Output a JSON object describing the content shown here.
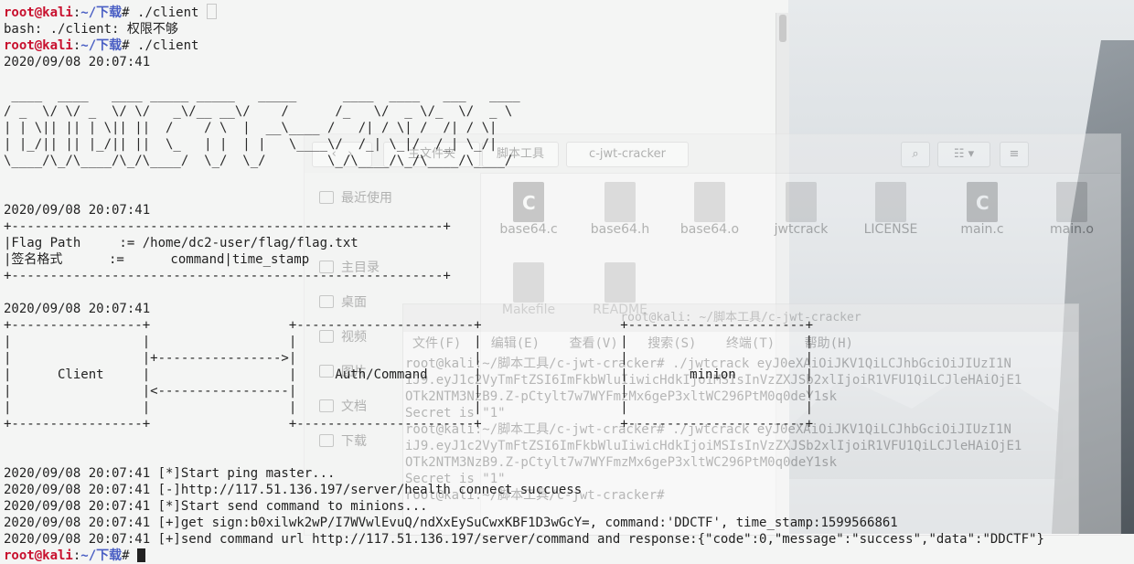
{
  "terminal": {
    "prompt_user": "root@kali",
    "prompt_sep": ":",
    "prompt_path": "~/下载",
    "prompt_hash": "# ",
    "cmd1": "./client",
    "error_line": "bash: ./client: 权限不够",
    "cmd2": "./client",
    "ts1": "2020/09/08 20:07:41",
    "banner": [
      " ____  ____   ____ _____ _____   _____      ____  ____   ___   ____ ",
      "/ _  \\/ \\/ _  \\/ \\/   _\\/__ __\\/    /      /_   \\/  _ \\/_  \\/  _ \\",
      "| | \\|| || | \\|| ||  /    / \\  |  __\\____ /   /| / \\| /  /| / \\|",
      "| |_/|| || |_/|| ||  \\_   | |  | |   \\____\\/  /_| \\_|/  /_| \\_/|",
      "\\____/\\_/\\____/\\_/\\____/  \\_/  \\_/        \\_/\\____/\\_/\\____/\\____/"
    ],
    "ts2": "2020/09/08 20:07:41",
    "table_border": "+--------------------------------------------------------+",
    "flag_row": "|Flag Path     := /home/dc2-user/flag/flag.txt",
    "sign_row": "|签名格式      :=      command|time_stamp",
    "ts3": "2020/09/08 20:07:41",
    "diagram": [
      "+-----------------+                  +-----------------------+                  +-----------------------+",
      "|                 |                  |                       |                  |                       |",
      "|                 |+---------------->|                       |                  |                       |",
      "|      Client     |                  |     Auth/Command      |                  |        minion         |",
      "|                 |<-----------------|                       |                  |                       |",
      "|                 |                  |                       |                  |                       |",
      "+-----------------+                  +-----------------------+                  +-----------------------+"
    ],
    "log": [
      "2020/09/08 20:07:41 [*]Start ping master...",
      "2020/09/08 20:07:41 [-]http://117.51.136.197/server/health connect succuess",
      "2020/09/08 20:07:41 [*]Start send command to minions...",
      "2020/09/08 20:07:41 [+]get sign:b0xilwk2wP/I7WVwlEvuQ/ndXxEySuCwxKBF1D3wGcY=, command:'DDCTF', time_stamp:1599566861",
      "2020/09/08 20:07:41 [+]send command url http://117.51.136.197/server/command and response:{\"code\":0,\"message\":\"success\",\"data\":\"DDCTF\"}"
    ]
  },
  "file_manager": {
    "breadcrumb": [
      "主文件夹",
      "脚本工具",
      "c-jwt-cracker"
    ],
    "sidebar": [
      "最近使用",
      "主目录",
      "桌面",
      "视频",
      "图片",
      "文档",
      "下载"
    ],
    "files": [
      "base64.c",
      "base64.h",
      "base64.o",
      "jwtcrack",
      "LICENSE",
      "main.c",
      "main.o",
      "Makefile",
      "README"
    ]
  },
  "terminal2": {
    "title": "root@kali: ~/脚本工具/c-jwt-cracker",
    "menu": [
      "文件(F)",
      "编辑(E)",
      "查看(V)",
      "搜索(S)",
      "终端(T)",
      "帮助(H)"
    ],
    "lines": [
      "root@kali:~/脚本工具/c-jwt-cracker# ./jwtcrack eyJ0eXAiOiJKV1QiLCJhbGciOiJIUzI1N",
      "iJ9.eyJ1c2VyTmFtZSI6ImFkbWluIiwicHdkIjoiMSIsInVzZXJSb2xlIjoiR1VFU1QiLCJleHAiOjE1",
      "OTk2NTM3NzB9.Z-pCtylt7w7WYFmzMx6geP3xltWC296PtM0q0deY1sk",
      "Secret is \"1\"",
      "root@kali:~/脚本工具/c-jwt-cracker# ./jwtcrack eyJ0eXAiOiJKV1QiLCJhbGciOiJIUzI1N",
      "iJ9.eyJ1c2VyTmFtZSI6ImFkbWluIiwicHdkIjoiMSIsInVzZXJSb2xlIjoiR1VFU1QiLCJleHAiOjE1",
      "OTk2NTM3NzB9.Z-pCtylt7w7WYFmzMx6geP3xltWC296PtM0q0deY1sk",
      "Secret is \"1\"",
      "root@kali:~/脚本工具/c-jwt-cracker# "
    ]
  }
}
